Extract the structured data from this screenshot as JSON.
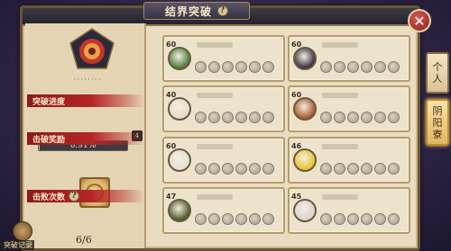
{
  "header": {
    "title": "结界突破",
    "help_icon": "?"
  },
  "close_icon": "✕",
  "left_panel": {
    "guild_name": "········",
    "progress_label": "突破进度",
    "progress_text": "0.91%",
    "progress_value": 0.0091,
    "rank_badge": "4",
    "reward_label": "击破奖励",
    "defeat_label": "击败次数",
    "defeat_help": "?",
    "defeat_count": "6/6"
  },
  "opponents": [
    {
      "level": "60",
      "avatar_color": "#4b7d3a"
    },
    {
      "level": "60",
      "avatar_color": "#3a3040"
    },
    {
      "level": "40",
      "avatar_color": "#e8dccd"
    },
    {
      "level": "60",
      "avatar_color": "#a85a2a"
    },
    {
      "level": "60",
      "avatar_color": "#e6e0d6"
    },
    {
      "level": "46",
      "avatar_color": "#e8c42a"
    },
    {
      "level": "47",
      "avatar_color": "#4d5a2a"
    },
    {
      "level": "45",
      "avatar_color": "#d8d4d0"
    }
  ],
  "side_tabs": [
    {
      "label_1": "个",
      "label_2": "人"
    },
    {
      "label_1": "阴",
      "label_2": "阳",
      "label_3": "寮"
    }
  ],
  "records_label": "突破记录",
  "colors": {
    "ribbon": "#b52626",
    "panel": "#e9dcc0",
    "close": "#8e2020"
  }
}
